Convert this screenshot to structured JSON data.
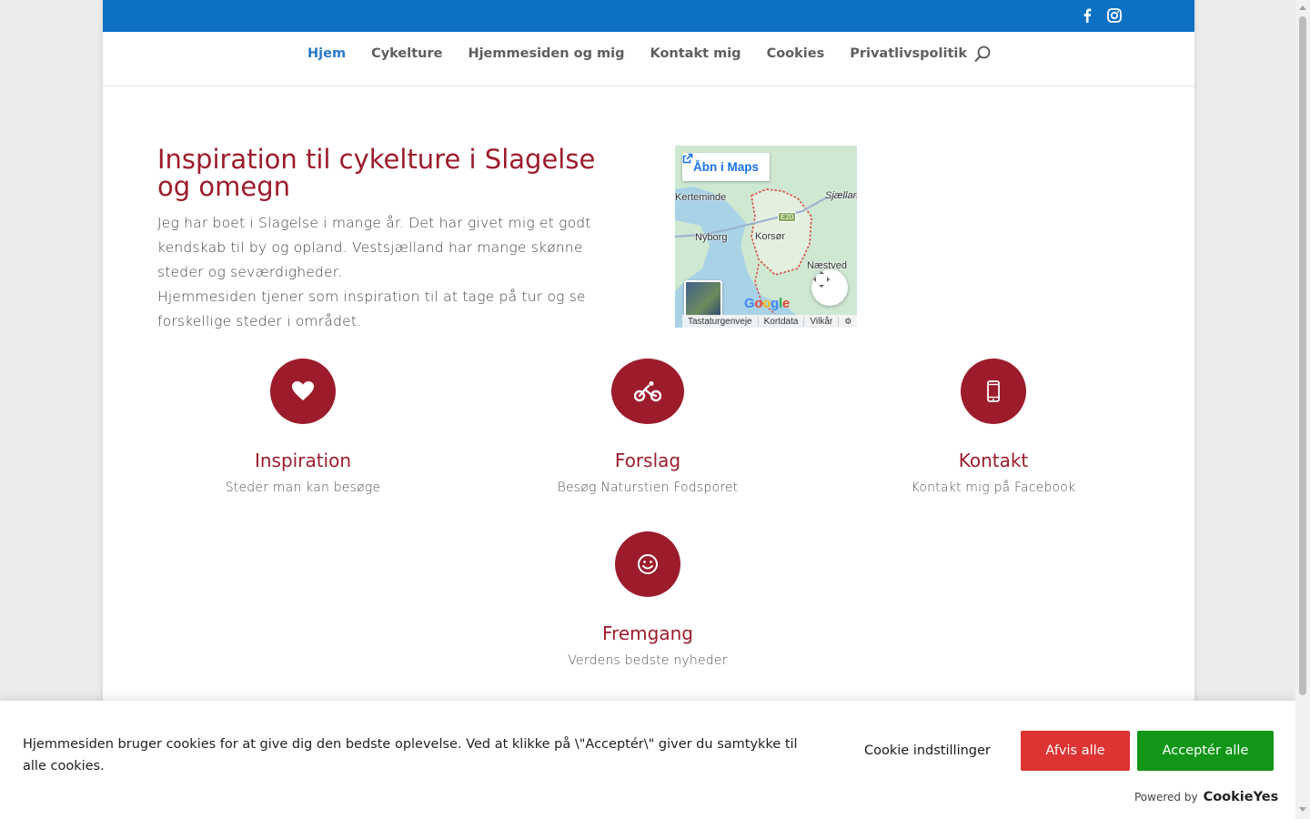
{
  "nav": {
    "items": [
      {
        "label": "Hjem",
        "active": true
      },
      {
        "label": "Cykelture"
      },
      {
        "label": "Hjemmesiden og mig"
      },
      {
        "label": "Kontakt mig"
      },
      {
        "label": "Cookies"
      },
      {
        "label": "Privatlivspolitik"
      }
    ]
  },
  "icons": {
    "facebook": "facebook-icon",
    "instagram": "instagram-icon",
    "search": "search-icon"
  },
  "intro": {
    "title": "Inspiration til cykelture i Slagelse og omegn",
    "paragraph1": "Jeg har boet i Slagelse i mange år. Det har givet mig et godt kendskab til by og opland. Vestsjælland har mange skønne steder og seværdigheder.",
    "paragraph2": "Hjemmesiden tjener som inspiration til at tage på tur og se forskellige steder i området."
  },
  "map": {
    "open_label": "Åbn i Maps",
    "places": [
      "Kerteminde",
      "Sjællan",
      "Nyborg",
      "Korsør",
      "Næstved"
    ],
    "road": "E20",
    "logo": "Google",
    "footer": [
      "Tastaturgenveje",
      "Kortdata",
      "Vilkår"
    ]
  },
  "features": [
    {
      "title": "Inspiration",
      "text": "Steder man kan besøge",
      "icon": "heart-icon"
    },
    {
      "title": "Forslag",
      "text": "Besøg Naturstien Fodsporet",
      "icon": "bicycle-icon"
    },
    {
      "title": "Kontakt",
      "text": "Kontakt mig på Facebook",
      "icon": "phone-icon"
    },
    {
      "title": "Fremgang",
      "text": "Verdens bedste nyheder",
      "icon": "smiley-icon"
    }
  ],
  "cookie": {
    "text": "Hjemmesiden bruger cookies for at give dig den bedste oplevelse. Ved at klikke på \\\"Acceptér\\\" giver du samtykke til alle cookies.",
    "settings_label": "Cookie indstillinger",
    "reject_label": "Afvis alle",
    "accept_label": "Acceptér alle",
    "powered_by": "Powered by",
    "brand": "CookieYes"
  },
  "colors": {
    "topbar": "#0c71c3",
    "accent": "#9c1c2c",
    "nav_active": "#2a7ac7",
    "reject": "#dd3333",
    "accept": "#119618"
  }
}
